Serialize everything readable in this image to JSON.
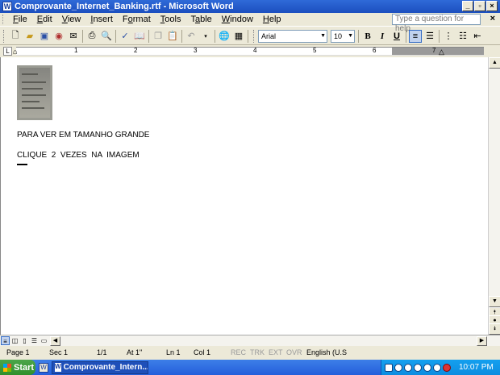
{
  "window": {
    "title": "Comprovante_Internet_Banking.rtf - Microsoft Word",
    "app_icon": "W"
  },
  "menu": {
    "items": [
      "File",
      "Edit",
      "View",
      "Insert",
      "Format",
      "Tools",
      "Table",
      "Window",
      "Help"
    ],
    "underlines": [
      "F",
      "E",
      "V",
      "I",
      "o",
      "T",
      "a",
      "W",
      "H"
    ],
    "help_placeholder": "Type a question for help",
    "close_doc": "×"
  },
  "toolbar": {
    "font": "Arial",
    "font_size": "10",
    "bold": "B",
    "italic": "I",
    "underline": "U"
  },
  "ruler": {
    "numbers": [
      "1",
      "2",
      "3",
      "4",
      "5",
      "6",
      "7"
    ]
  },
  "document": {
    "line1": "PARA VER EM TAMANHO GRANDE",
    "line2": "CLIQUE  2  VEZES  NA  IMAGEM"
  },
  "status": {
    "page": "Page  1",
    "sec": "Sec  1",
    "pages": "1/1",
    "at": "At  1\"",
    "ln": "Ln  1",
    "col": "Col  1",
    "rec": "REC",
    "trk": "TRK",
    "ext": "EXT",
    "ovr": "OVR",
    "language": "English (U.S"
  },
  "taskbar": {
    "start": "Start",
    "task_button": "Comprovante_Intern...",
    "clock": "10:07 PM"
  },
  "colors": {
    "title_bar": "#1c4fbf",
    "taskbar": "#245edb",
    "start_button": "#2f8f2c"
  }
}
